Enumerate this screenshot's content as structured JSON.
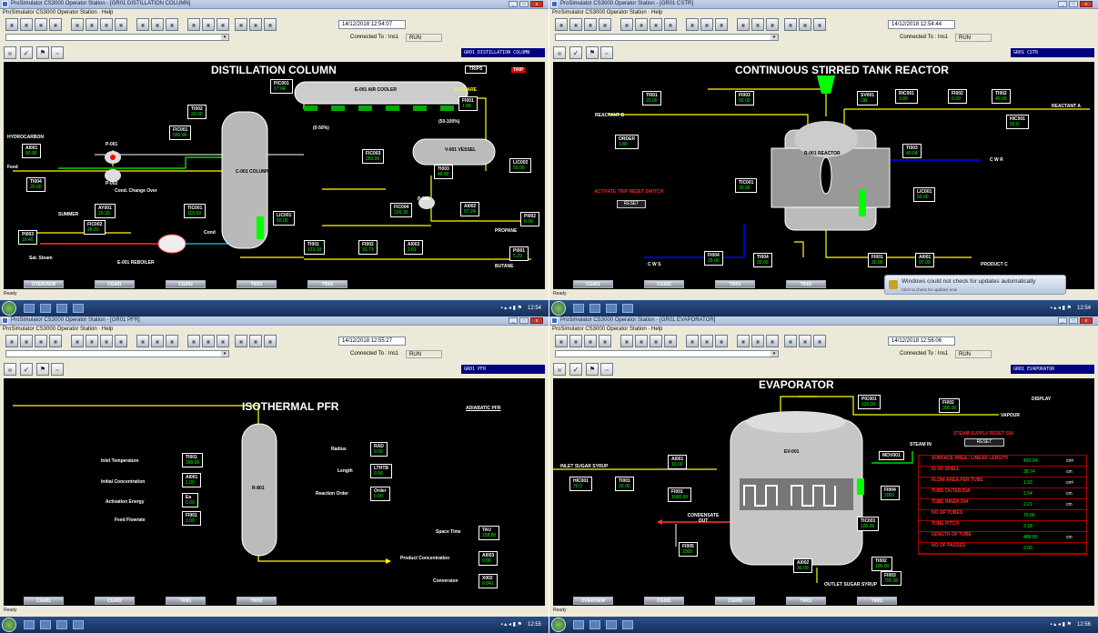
{
  "windows": [
    {
      "title": "ProSimulator CS3000 Operator Station - [GR01 DISTILLATION COLUMN]",
      "menu": "ProSimulator CS3000 Operator Station · Help",
      "datetime": "14/12/2018 12:54:07",
      "connected": "Connected To : Ins1",
      "status": "RUN",
      "panel_label": "GR01 DISTILLATION COLUMN",
      "tabs": [
        "OVERVIEW",
        "CG001",
        "CG002",
        "TI001",
        "TI002"
      ],
      "tray_time": "12:54"
    },
    {
      "title": "ProSimulator CS3000 Operator Station - [GR01 CSTR]",
      "menu": "ProSimulator CS3000 Operator Station · Help",
      "datetime": "14/12/2018 12:54:44",
      "connected": "Connected To : Ins1",
      "status": "RUN",
      "panel_label": "GR01 CSTR",
      "tabs": [
        "CG001",
        "CG002",
        "TI001",
        "TI002"
      ],
      "tray_time": "12:54"
    },
    {
      "title": "ProSimulator CS3000 Operator Station - [GR01 PFR]",
      "menu": "ProSimulator CS3000 Operator Station · Help",
      "datetime": "14/12/2018 12:55:27",
      "connected": "Connected To : Ins1",
      "status": "RUN",
      "panel_label": "GR01 PFR",
      "tabs": [
        "CG001",
        "CG002",
        "TI001",
        "TI002"
      ],
      "tray_time": "12:55"
    },
    {
      "title": "ProSimulator CS3000 Operator Station - [GR01 EVAPORATOR]",
      "menu": "ProSimulator CS3000 Operator Station · Help",
      "datetime": "14/12/2018 12:56:06",
      "connected": "Connected To : Ins1",
      "status": "RUN",
      "panel_label": "GR01 EVAPORATOR",
      "tabs": [
        "OVERVIEW",
        "CG001",
        "CG002",
        "TI001",
        "TI002"
      ],
      "tray_time": "12:56"
    }
  ],
  "ready_text": "Ready",
  "dist": {
    "title": "DISTILLATION COLUMN",
    "trips": "TRIPS",
    "trip_red": "TRIP",
    "air_cooler": "E-001 AIR COOLER",
    "to_flare": "TO FLARE",
    "hydrocarbon": "HYDROCARBON",
    "feed": "Feed",
    "summer": "SUMMER",
    "sat_steam": "Sat. Steam",
    "cond": "Cond",
    "reboiler": "E-001 REBOILER",
    "column": "C-001 COLUMN",
    "vessel": "V-001 VESSEL",
    "propane": "PROPANE",
    "butane": "BUTANE",
    "p001": "P-001",
    "p002": "P-002",
    "p003": "P-003",
    "pct1": "(0-50%)",
    "pct2": "(50-100%)",
    "cond_change": "Cond. Change Over",
    "tags": {
      "pic001": "PIC001",
      "pic001_v": "17.04",
      "ti002": "TI002",
      "ti002_v": "20.00",
      "fi001": "FI001",
      "fi001_v": "1.88",
      "fic001": "FIC001",
      "fic001_v": "500.00",
      "ai001": "AI001",
      "ai001_v": "60.00",
      "ti004": "TI004",
      "ti004_v": "20.00",
      "ay001": "AY001",
      "ay001_v": "20.33",
      "fic002": "FIC002",
      "fic002_v": "26.01",
      "pi003": "PI003",
      "pi003_v": "16.40",
      "tic001": "TIC001",
      "tic001_v": "110.59",
      "lic001": "LIC001",
      "lic001_v": "50.00",
      "fic003": "FIC003",
      "fic003_v": "282.00",
      "ti003": "TI003",
      "ti003_v": "40.00",
      "lic002": "LIC002",
      "lic002_v": "50.00",
      "fic004": "FIC004",
      "fic004_v": "226.10",
      "ai002": "AI002",
      "ai002_v": "97.24",
      "pi002": "PI002",
      "pi002_v": "8.00",
      "ti001": "TI001",
      "ti001_v": "123.10",
      "fi002": "FI002",
      "fi002_v": "31.73",
      "ai003": "AI003",
      "ai003_v": "2.61",
      "pi001": "PI001",
      "pi001_v": "5.29"
    }
  },
  "cstr": {
    "title": "CONTINUOUS STIRRED TANK REACTOR",
    "reactant_b": "REACTANT B",
    "reactant_a": "REACTANT A",
    "order": "ORDER",
    "order_v": "1.80",
    "reactor": "R-001 REACTOR",
    "cwr": "C W R",
    "cws": "C W S",
    "product": "PRODUCT C",
    "trip_text": "ACTIVATE TRIP RESET SWITCH",
    "reset": "RESET",
    "tags": {
      "ti001": "TI001",
      "ti001_v": "20.00",
      "fi003": "FI003",
      "fi003_v": "50.00",
      "sv001": "SV001",
      "sv001_v": "ON",
      "ric001": "RIC001",
      "ric001_pv": "1.00",
      "ric001_sv": "1.00",
      "fi002": "FI002",
      "fi002_v": "0.00",
      "ti002": "TI002",
      "ti002_v": "40.00",
      "hic001": "HIC001",
      "hic001_v": "50.0",
      "ti003": "TI003",
      "ti003_v": "40.64",
      "tic001": "TIC001",
      "tic001_pv": "30.00",
      "tic001_sv": "30.00",
      "lic001": "LIC001",
      "lic001_pv": "50.00",
      "lic001_sv": "50.00",
      "fi004": "FI004",
      "fi004_v": "25.00",
      "ti004": "TI004",
      "ti004_v": "20.00",
      "fi001": "FI001",
      "fi001_v": "30.00",
      "ai001": "AI001",
      "ai001_v": "97.00"
    },
    "notif_title": "Windows could not check for updates automatically",
    "notif_sub": "Click to check for updates now"
  },
  "pfr": {
    "title": "ISOTHERMAL PFR",
    "adiabatic": "ADIABATIC PFR",
    "inlet_temp": "Inlet Temperature",
    "inlet_tag": "TI001",
    "inlet_v": "300.00",
    "init_conc": "Initial Concentration",
    "conc_tag": "AI001",
    "conc_v": "1.00",
    "act_energy": "Activation Energy",
    "ea_tag": "Ea",
    "ea_v": "0.00",
    "feed_flow": "Feed Flowrate",
    "flow_tag": "FI001",
    "flow_v": "1.00",
    "reactor": "R-801",
    "radius": "Radius",
    "rad_tag": "RAD",
    "rad_v": "0.00",
    "length": "Length",
    "len_tag": "LTHTB",
    "len_v": "0.00",
    "order": "Reaction Order",
    "order_tag": "Order",
    "order_v": "0.00",
    "space_time": "Space Time",
    "tau_tag": "TAU",
    "tau_v": "258.80",
    "prod_conc": "Product Concentration",
    "ai_tag": "AI003",
    "ai_v": "0.00",
    "conversion": "Conversion",
    "x_tag": "X002",
    "x_v": "0.041"
  },
  "evap": {
    "title": "EVAPORATOR",
    "display": "DISPLAY",
    "vapour": "VAPOUR",
    "steam_in": "STEAM IN",
    "inlet": "INLET SUGAR SYRUP",
    "ev": "EV-001",
    "condensate": "CONDENSATE OUT",
    "outlet": "OUTLET SUGAR SYRUP",
    "trip_text": "STEAM SUPPLY RESET SW",
    "reset": "RESET",
    "tags": {
      "pic001": "PIC001",
      "pic001_pv": "120.00",
      "pic001_sv": "120.00",
      "fi002": "FI002",
      "fi002_v": "300.00",
      "mov001": "MOV001",
      "ai001": "AI001",
      "ai001_v": "10.00",
      "fi004": "FI004",
      "fi004_v": "2000",
      "hic001": "HIC001",
      "hic001_v": "70.0",
      "ti001": "TI001",
      "ti001_v": "20.00",
      "fi001": "FI001",
      "fi001_v": "1000.00",
      "tic001": "TIC001",
      "tic001_pv": "100.00",
      "tic001_sv": "100.00",
      "fi005": "FI005",
      "fi005_v": "2000",
      "ai002": "AI002",
      "ai002_v": "30.00",
      "ti002": "TI002",
      "ti002_v": "100.00",
      "fi003": "FI003",
      "fi003_v": "700.00"
    },
    "table": [
      {
        "name": "SURFACE AREA / LINEAR LENGTH",
        "value": "420.04",
        "unit": "cm²"
      },
      {
        "name": "ID OF SHELL",
        "value": "38.74",
        "unit": "cm"
      },
      {
        "name": "FLOW AREA PER TUBE",
        "value": "1.93",
        "unit": "cm²"
      },
      {
        "name": "TUBE OUTER DIA",
        "value": "2.54",
        "unit": "cm"
      },
      {
        "name": "TUBE INNER DIA",
        "value": "2.21",
        "unit": "cm"
      },
      {
        "name": "NO OF TUBES",
        "value": "70.00",
        "unit": ""
      },
      {
        "name": "TUBE PITCH",
        "value": "3.18",
        "unit": ""
      },
      {
        "name": "LENGTH OF TUBE",
        "value": "488.00",
        "unit": "cm"
      },
      {
        "name": "NO OF PASSES",
        "value": "2.00",
        "unit": ""
      }
    ]
  }
}
